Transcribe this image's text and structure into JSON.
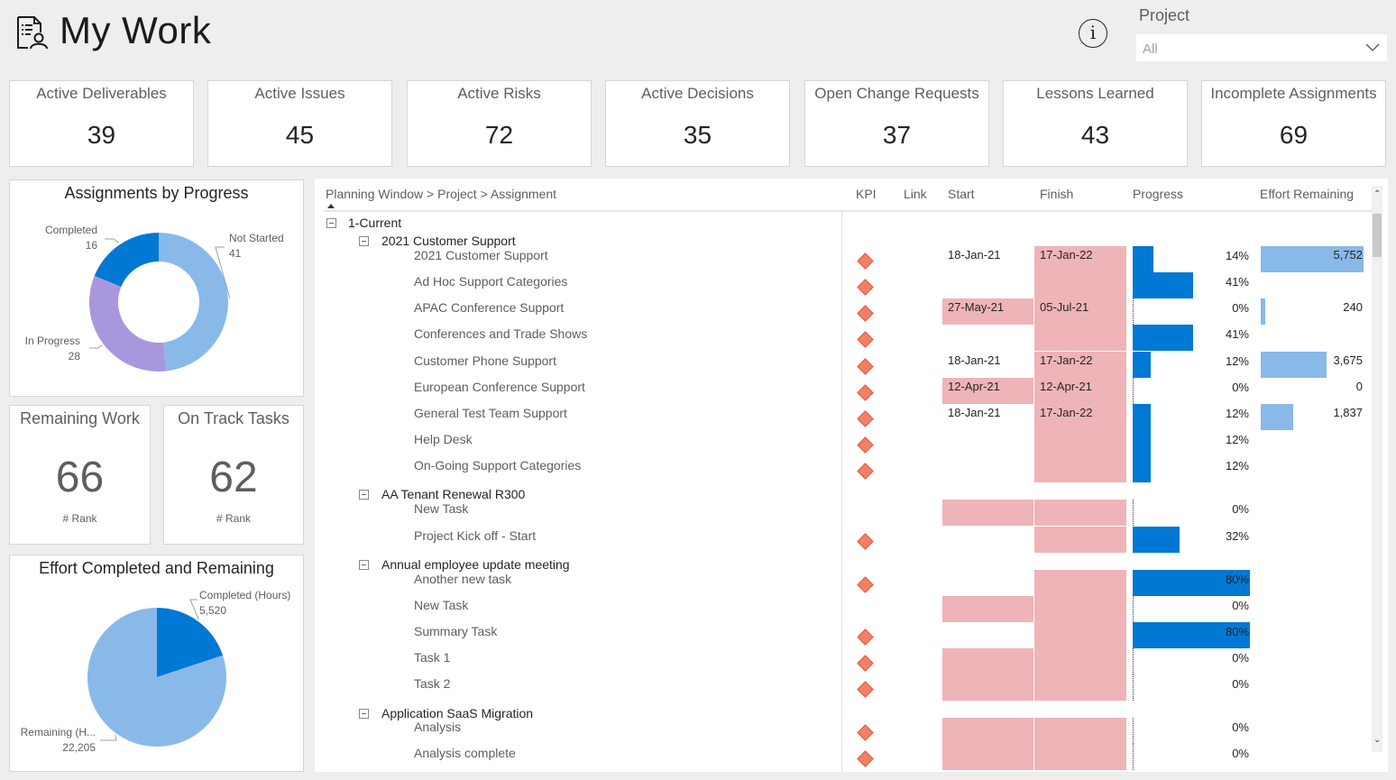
{
  "header": {
    "title": "My Work",
    "title_icon": "report-user-icon",
    "info_icon": "info-icon",
    "slicer": {
      "label": "Project",
      "value": "All",
      "icon": "chevron-down-icon"
    }
  },
  "kpis": [
    {
      "label": "Active Deliverables",
      "value": "39"
    },
    {
      "label": "Active Issues",
      "value": "45"
    },
    {
      "label": "Active Risks",
      "value": "72"
    },
    {
      "label": "Active Decisions",
      "value": "35"
    },
    {
      "label": "Open Change Requests",
      "value": "37"
    },
    {
      "label": "Lessons Learned",
      "value": "43"
    },
    {
      "label": "Incomplete Assignments",
      "value": "69"
    }
  ],
  "cards": [
    {
      "title": "Remaining Work",
      "value": "66",
      "sub": "# Rank"
    },
    {
      "title": "On Track Tasks",
      "value": "62",
      "sub": "# Rank"
    }
  ],
  "chart_data": [
    {
      "type": "pie",
      "variant": "donut",
      "title": "Assignments by Progress",
      "categories": [
        "Not Started",
        "In Progress",
        "Completed"
      ],
      "values": [
        41,
        28,
        16
      ],
      "colors": [
        "#89b9e9",
        "#a997dd",
        "#0078d4"
      ],
      "data_labels": [
        "41",
        "28",
        "16"
      ]
    },
    {
      "type": "pie",
      "title": "Effort Completed and Remaining",
      "categories": [
        "Completed (Hours)",
        "Remaining (H..."
      ],
      "values": [
        5520,
        22205
      ],
      "colors": [
        "#0078d4",
        "#89b9e9"
      ],
      "data_labels": [
        "5,520",
        "22,205"
      ]
    }
  ],
  "matrix": {
    "headers": {
      "hierarchy": "Planning Window > Project > Assignment",
      "kpi": "KPI",
      "link": "Link",
      "start": "Start",
      "finish": "Finish",
      "progress": "Progress",
      "effort": "Effort Remaining"
    },
    "colors": {
      "kpi": "#f47f67",
      "late": "#efb4b8",
      "progress": "#0078d4",
      "effort": "#89b9e9"
    },
    "effort_max": 5752,
    "rows": [
      {
        "level": 1,
        "label": "1-Current"
      },
      {
        "level": 2,
        "label": "2021 Customer Support"
      },
      {
        "level": 3,
        "label": "2021 Customer Support",
        "kpi": true,
        "start": "18-Jan-21",
        "finish": "17-Jan-22",
        "start_late": false,
        "finish_late": true,
        "progress": 14,
        "effort": 5752,
        "effort_label": "5,752"
      },
      {
        "level": 3,
        "label": "Ad Hoc Support Categories",
        "kpi": true,
        "start": "",
        "finish": "",
        "start_late": false,
        "finish_late": true,
        "progress": 41
      },
      {
        "level": 3,
        "label": "APAC Conference Support",
        "kpi": true,
        "start": "27-May-21",
        "finish": "05-Jul-21",
        "start_late": true,
        "finish_late": true,
        "progress": 0,
        "effort": 240,
        "effort_label": "240"
      },
      {
        "level": 3,
        "label": "Conferences and Trade Shows",
        "kpi": true,
        "start": "",
        "finish": "",
        "start_late": false,
        "finish_late": true,
        "progress": 41
      },
      {
        "level": 3,
        "label": "Customer Phone Support",
        "kpi": true,
        "start": "18-Jan-21",
        "finish": "17-Jan-22",
        "start_late": false,
        "finish_late": true,
        "progress": 12,
        "effort": 3675,
        "effort_label": "3,675"
      },
      {
        "level": 3,
        "label": "European Conference Support",
        "kpi": true,
        "start": "12-Apr-21",
        "finish": "12-Apr-21",
        "start_late": true,
        "finish_late": true,
        "progress": 0,
        "effort": 0,
        "effort_label": "0"
      },
      {
        "level": 3,
        "label": "General Test Team Support",
        "kpi": true,
        "start": "18-Jan-21",
        "finish": "17-Jan-22",
        "start_late": false,
        "finish_late": true,
        "progress": 12,
        "effort": 1837,
        "effort_label": "1,837"
      },
      {
        "level": 3,
        "label": "Help Desk",
        "kpi": true,
        "start": "",
        "finish": "",
        "start_late": false,
        "finish_late": true,
        "progress": 12
      },
      {
        "level": 3,
        "label": "On-Going Support Categories",
        "kpi": true,
        "start": "",
        "finish": "",
        "start_late": false,
        "finish_late": true,
        "progress": 12
      },
      {
        "level": 2,
        "label": "AA Tenant Renewal R300"
      },
      {
        "level": 3,
        "label": "New Task",
        "kpi": false,
        "start": "",
        "finish": "",
        "start_late": true,
        "finish_late": true,
        "progress": 0
      },
      {
        "level": 3,
        "label": "Project Kick off - Start",
        "kpi": true,
        "start": "",
        "finish": "",
        "start_late": false,
        "finish_late": true,
        "progress": 32
      },
      {
        "level": 2,
        "label": "Annual employee update meeting"
      },
      {
        "level": 3,
        "label": "Another new task",
        "kpi": true,
        "start": "",
        "finish": "",
        "start_late": false,
        "finish_late": true,
        "progress": 80
      },
      {
        "level": 3,
        "label": "New Task",
        "kpi": false,
        "start": "",
        "finish": "",
        "start_late": true,
        "finish_late": true,
        "progress": 0
      },
      {
        "level": 3,
        "label": "Summary Task",
        "kpi": true,
        "start": "",
        "finish": "",
        "start_late": false,
        "finish_late": true,
        "progress": 80
      },
      {
        "level": 3,
        "label": "Task 1",
        "kpi": true,
        "start": "",
        "finish": "",
        "start_late": true,
        "finish_late": true,
        "progress": 0
      },
      {
        "level": 3,
        "label": "Task 2",
        "kpi": true,
        "start": "",
        "finish": "",
        "start_late": true,
        "finish_late": true,
        "progress": 0
      },
      {
        "level": 2,
        "label": "Application SaaS Migration"
      },
      {
        "level": 3,
        "label": "Analysis",
        "kpi": true,
        "start": "",
        "finish": "",
        "start_late": true,
        "finish_late": true,
        "progress": 0
      },
      {
        "level": 3,
        "label": "Analysis complete",
        "kpi": true,
        "start": "",
        "finish": "",
        "start_late": true,
        "finish_late": true,
        "progress": 0
      }
    ]
  }
}
